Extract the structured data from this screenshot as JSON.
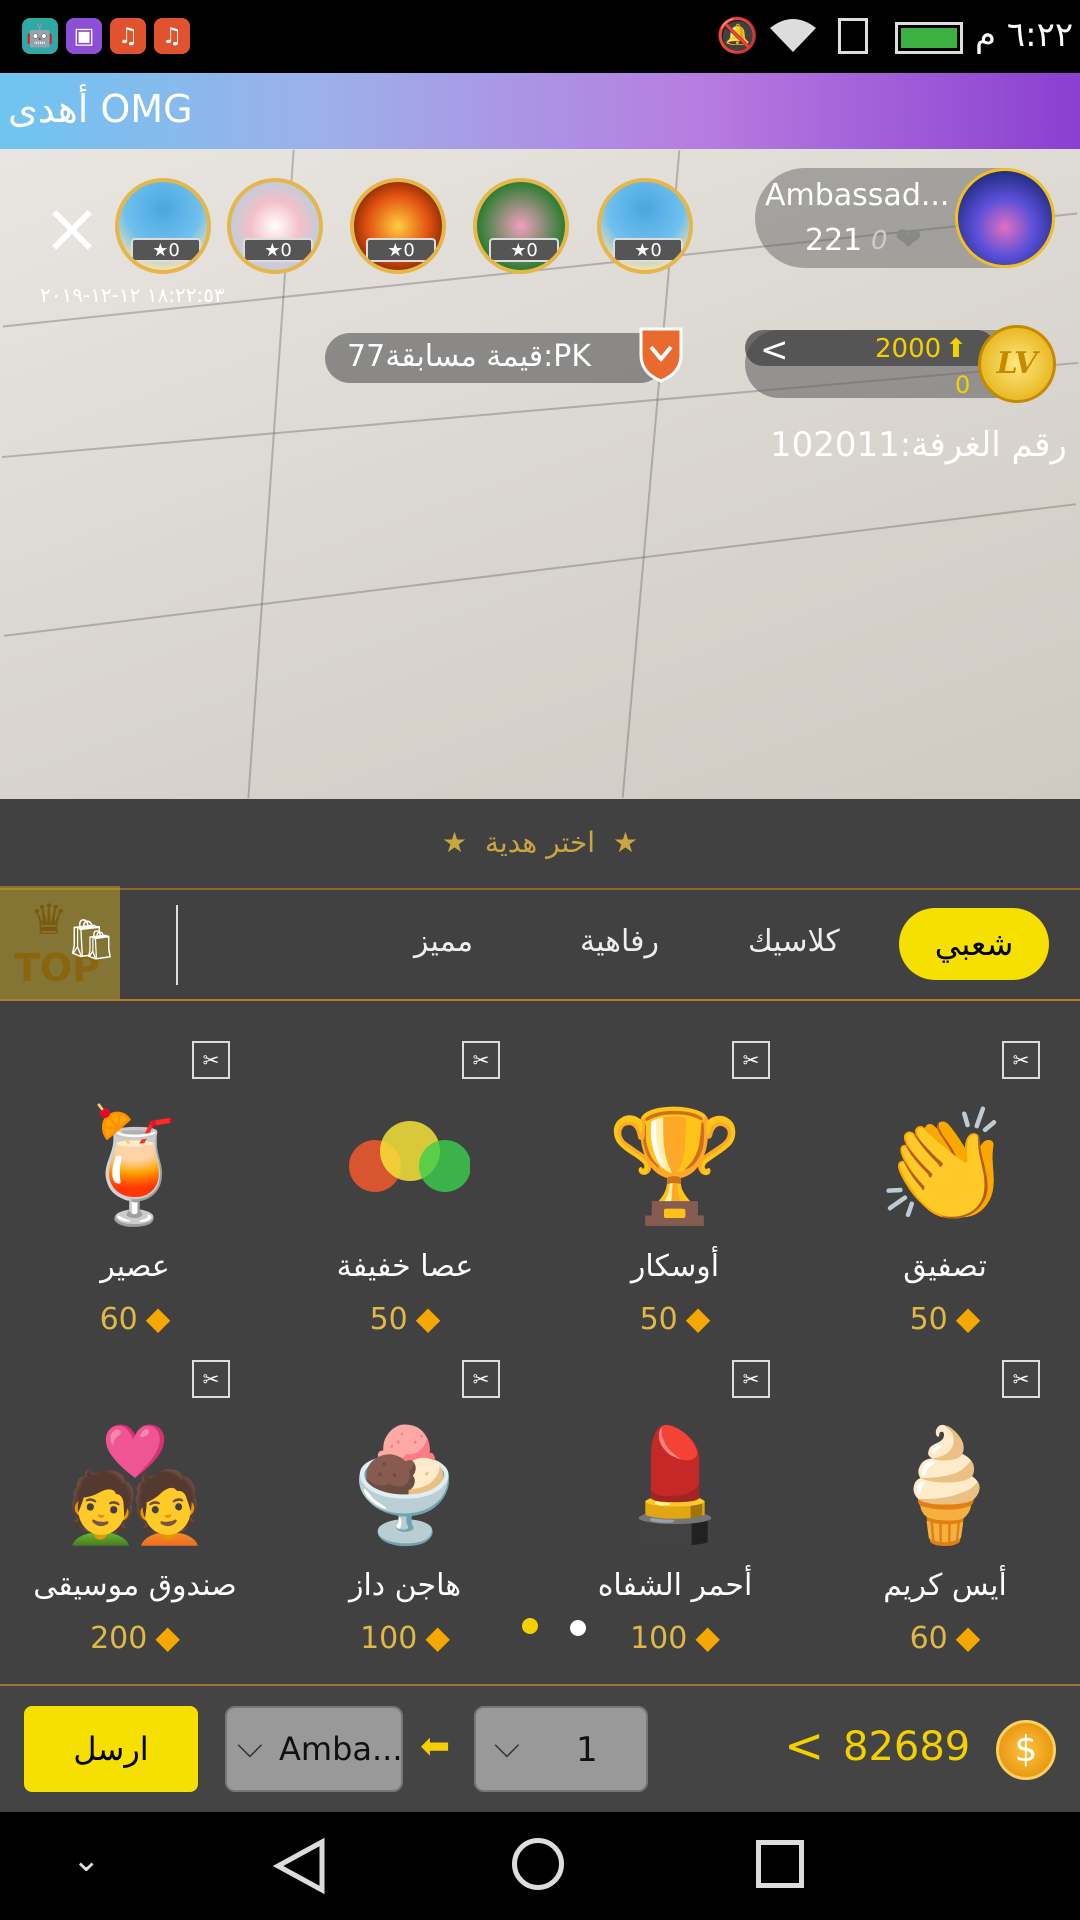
{
  "status_bar": {
    "time": "٦:٢٢ م",
    "icons": [
      "android-icon",
      "gallery-icon",
      "music-icon",
      "music-icon",
      "mute-icon",
      "wifi-icon",
      "sim-icon",
      "battery-charging-icon"
    ]
  },
  "marquee": {
    "text": "أهدى OMG"
  },
  "room": {
    "host_name": "Ambassad...",
    "host_count": "221",
    "host_likes": "0",
    "audience_badges": [
      "0",
      "0",
      "0",
      "0",
      "0"
    ],
    "datetime": "١٨:٢٢:٥٣ ١٢-١٢-٢٠١٩",
    "pk_label": "قيمة مسابقة77:PK",
    "level_exp": "2000",
    "level_zero": "0",
    "lv_label": "LV",
    "room_number": "رقم الغرفة:102011"
  },
  "gift_panel": {
    "title": "اختر هدية",
    "tabs": [
      "شعبي",
      "كلاسيك",
      "رفاهية",
      "مميز"
    ],
    "top_label": "TOP",
    "gifts": [
      {
        "name": "تصفيق",
        "price": "50",
        "icon": "clap-icon"
      },
      {
        "name": "أوسكار",
        "price": "50",
        "icon": "oscar-icon"
      },
      {
        "name": "عصا خفيفة",
        "price": "50",
        "icon": "glow-stick-icon"
      },
      {
        "name": "عصير",
        "price": "60",
        "icon": "juice-icon"
      },
      {
        "name": "أيس كريم",
        "price": "60",
        "icon": "ice-cream-icon"
      },
      {
        "name": "أحمر الشفاه",
        "price": "100",
        "icon": "lipstick-icon"
      },
      {
        "name": "هاجن داز",
        "price": "100",
        "icon": "sundae-icon"
      },
      {
        "name": "صندوق موسيقى",
        "price": "200",
        "icon": "music-box-icon"
      }
    ]
  },
  "send_bar": {
    "send_label": "ارسل",
    "recipient": "Amba...",
    "quantity": "1",
    "balance": "82689"
  },
  "colors": {
    "accent_yellow": "#f6e000",
    "gold": "#e0b846",
    "panel": "#464646"
  }
}
